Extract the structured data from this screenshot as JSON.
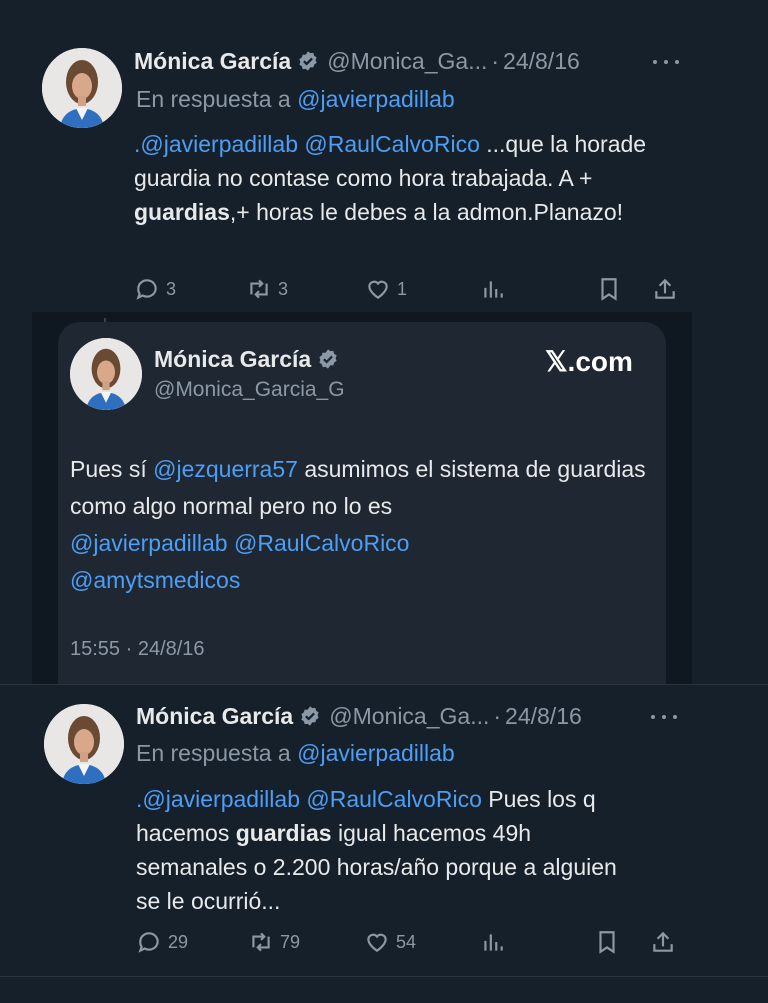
{
  "tweet1": {
    "name": "Mónica García",
    "handle": "@Monica_Ga...",
    "date": "24/8/16",
    "reply_prefix": "En respuesta a",
    "reply_handle": "@javierpadillab",
    "text_parts": {
      "m1": ".@javierpadillab",
      "m2": "@RaulCalvoRico",
      "t1": " ...que la horade guardia no contase como hora trabajada. A + ",
      "b1": "guardias",
      "t2": ",+ horas le debes a la admon.Planazo!"
    },
    "stats": {
      "replies": "3",
      "retweets": "3",
      "likes": "1"
    }
  },
  "card": {
    "name": "Mónica García",
    "handle": "@Monica_Garcia_G",
    "brand": "𝕏.com",
    "text_parts": {
      "t1": "Pues sí ",
      "m1": "@jezquerra57",
      "t2": " asumimos el sistema de guardias como algo normal pero no lo es",
      "m2": "@javierpadillab",
      "m3": "@RaulCalvoRico",
      "m4": "@amytsmedicos"
    },
    "time": "15:55 · 24/8/16"
  },
  "tweet2": {
    "name": "Mónica García",
    "handle": "@Monica_Ga...",
    "date": "24/8/16",
    "reply_prefix": "En respuesta a",
    "reply_handle": "@javierpadillab",
    "text_parts": {
      "m1": ".@javierpadillab",
      "m2": "@RaulCalvoRico",
      "t1": " Pues los q hacemos ",
      "b1": "guardias",
      "t2": " igual hacemos 49h semanales o 2.200 horas/año porque a alguien se le ocurrió..."
    },
    "stats": {
      "replies": "29",
      "retweets": "79",
      "likes": "54"
    }
  },
  "icons": [
    "verified-icon",
    "more-icon",
    "reply-icon",
    "retweet-icon",
    "like-icon",
    "views-icon",
    "bookmark-icon",
    "share-icon"
  ],
  "colors": {
    "background": "#15202b",
    "accent": "#4d9ef5",
    "muted": "#8b98a5",
    "verified": "#8b98a5"
  }
}
